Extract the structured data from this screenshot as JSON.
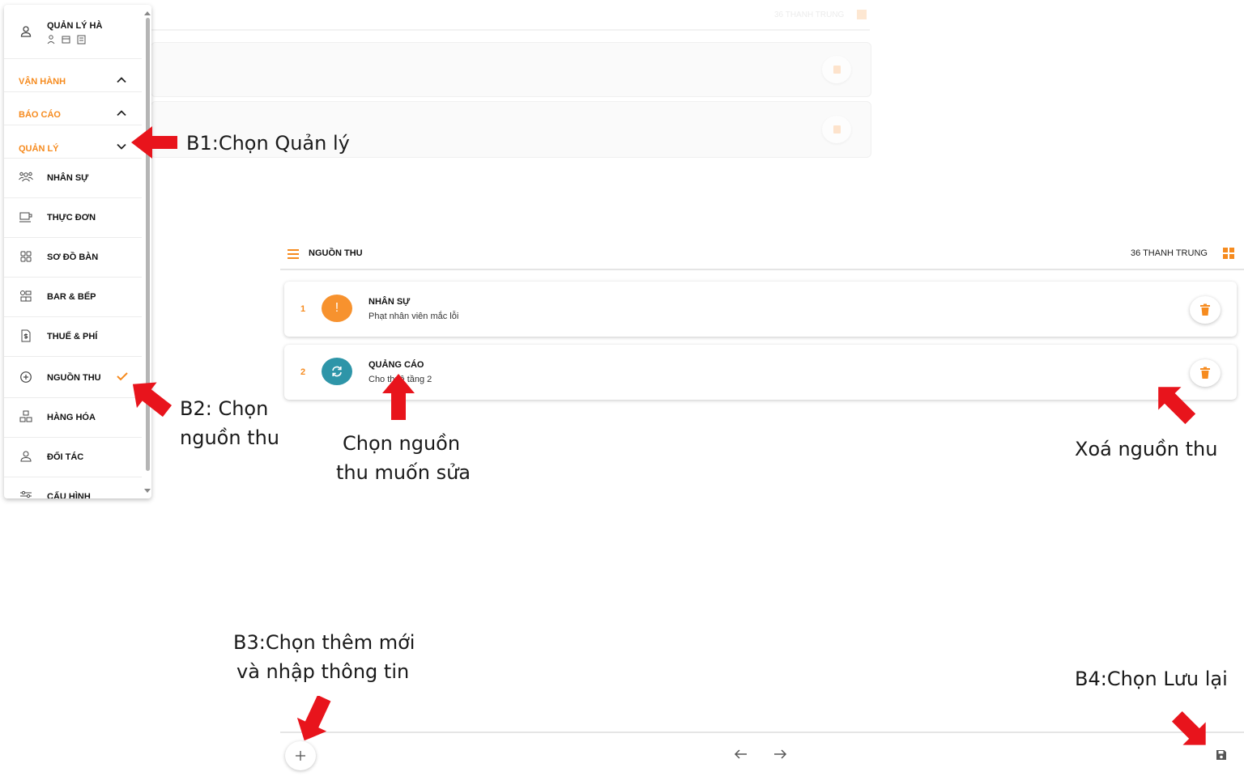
{
  "colors": {
    "accent": "#f68b1f",
    "teal": "#2e95a8",
    "arrow_red": "#e8141c"
  },
  "sidebar": {
    "user": {
      "name": "QUẢN LÝ HÀ",
      "icon": "user-icon"
    },
    "sections": [
      {
        "label": "VẬN HÀNH",
        "state": "collapsed"
      },
      {
        "label": "BÁO CÁO",
        "state": "collapsed"
      },
      {
        "label": "QUẢN LÝ",
        "state": "expanded"
      }
    ],
    "items": [
      {
        "label": "NHÂN SỰ",
        "icon": "people-icon"
      },
      {
        "label": "THỰC ĐƠN",
        "icon": "coffee-cup-icon"
      },
      {
        "label": "SƠ ĐỒ BÀN",
        "icon": "grid-icon"
      },
      {
        "label": "BAR & BẾP",
        "icon": "kitchen-icon"
      },
      {
        "label": "THUẾ & PHÍ",
        "icon": "tax-document-icon"
      },
      {
        "label": "NGUỒN THU",
        "icon": "plus-circle-icon",
        "selected": true
      },
      {
        "label": "HÀNG HÓA",
        "icon": "boxes-icon"
      },
      {
        "label": "ĐỐI TÁC",
        "icon": "partner-icon"
      },
      {
        "label": "CẤU HÌNH",
        "icon": "settings-sliders-icon"
      }
    ]
  },
  "header": {
    "title": "NGUỒN THU",
    "user": "36 THANH TRUNG"
  },
  "rows": [
    {
      "index": "1",
      "title": "NHÂN SỰ",
      "subtitle": "Phạt nhân viên mắc lỗi",
      "icon_text": "!",
      "color": "#f7922e"
    },
    {
      "index": "2",
      "title": "QUẢNG CÁO",
      "subtitle": "Cho thuê tầng 2",
      "icon_text": "",
      "color": "#2e95a8"
    }
  ],
  "annotations": {
    "b1": "B1:Chọn Quản lý",
    "b2_line1": "B2: Chọn",
    "b2_line2": "nguồn thu",
    "edit_line1": "Chọn nguồn",
    "edit_line2": "thu muốn sửa",
    "delete": "Xoá nguồn thu",
    "b3_line1": "B3:Chọn thêm mới",
    "b3_line2": "và nhập thông tin",
    "b4": "B4:Chọn Lưu lại"
  }
}
